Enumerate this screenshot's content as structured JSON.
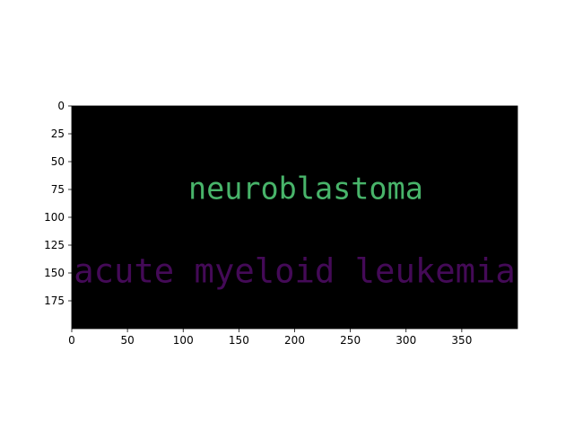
{
  "chart_data": {
    "type": "wordcloud",
    "title": "",
    "xlabel": "",
    "ylabel": "",
    "xlim": [
      0,
      400
    ],
    "ylim": [
      200,
      0
    ],
    "y_inverted": true,
    "grid": false,
    "background_color": "#000000",
    "x_ticks": [
      0,
      50,
      100,
      150,
      200,
      250,
      300,
      350
    ],
    "y_ticks": [
      0,
      25,
      50,
      75,
      100,
      125,
      150,
      175
    ],
    "words": [
      {
        "text": "neuroblastoma",
        "x": 210,
        "y": 76,
        "size": 27,
        "color": "#48b46a"
      },
      {
        "text": "acute myeloid leukemia",
        "x": 200,
        "y": 150,
        "size": 30,
        "color": "#440a57"
      }
    ]
  }
}
